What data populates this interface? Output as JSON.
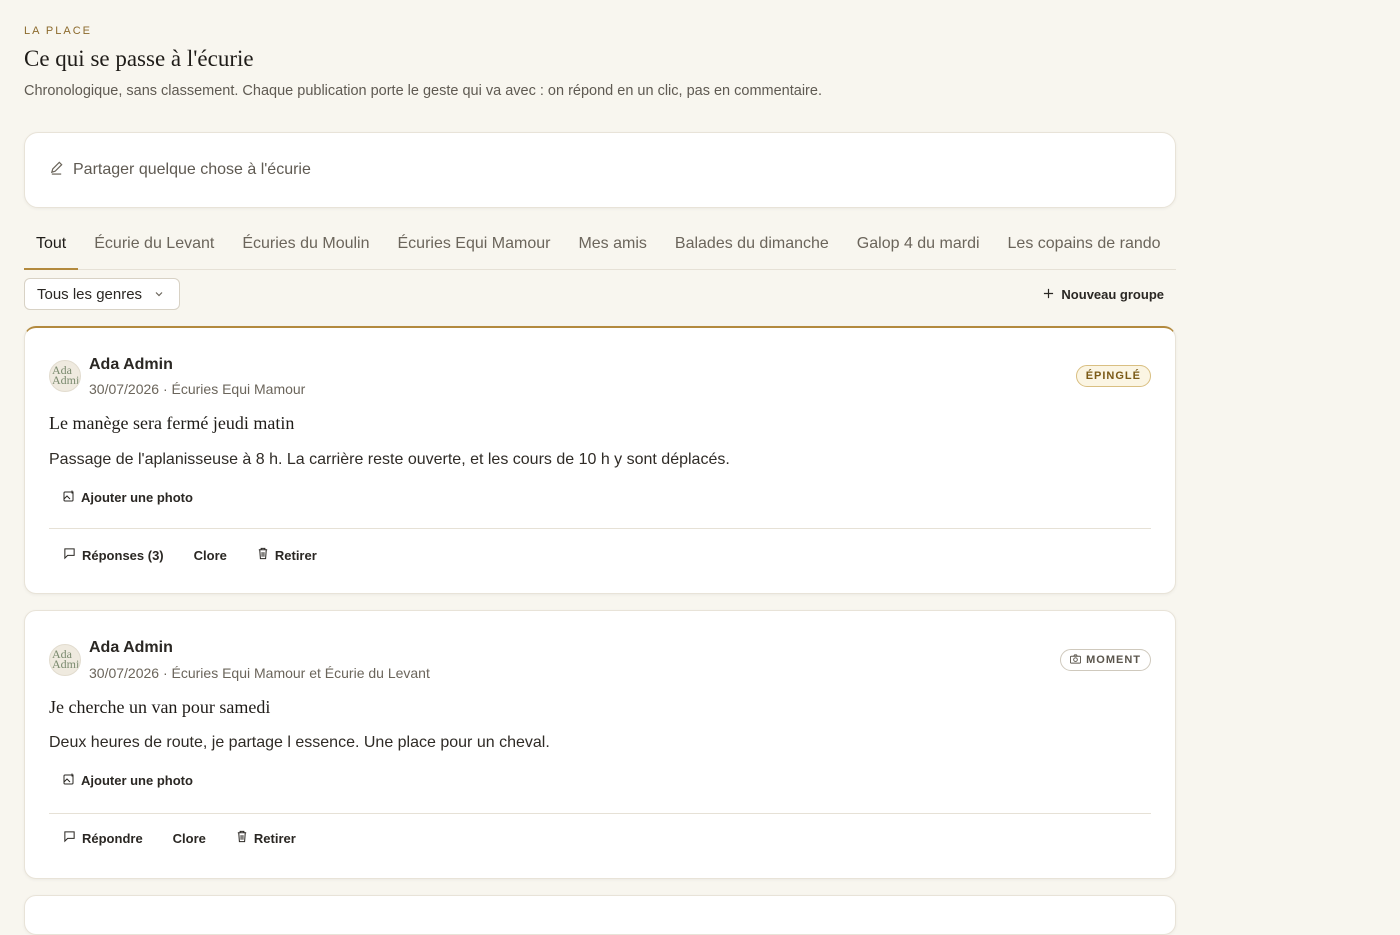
{
  "header": {
    "eyebrow": "LA PLACE",
    "title": "Ce qui se passe à l'écurie",
    "subtitle": "Chronologique, sans classement. Chaque publication porte le geste qui va avec : on répond en un clic, pas en commentaire."
  },
  "composer": {
    "placeholder": "Partager quelque chose à l'écurie",
    "icon": "pencil-icon"
  },
  "tabs": [
    {
      "label": "Tout",
      "active": true
    },
    {
      "label": "Écurie du Levant"
    },
    {
      "label": "Écuries du Moulin"
    },
    {
      "label": "Écuries Equi Mamour"
    },
    {
      "label": "Mes amis"
    },
    {
      "label": "Balades du dimanche"
    },
    {
      "label": "Galop 4 du mardi"
    },
    {
      "label": "Les copains de rando"
    }
  ],
  "toolbar": {
    "genre_select": "Tous les genres",
    "new_group": "Nouveau groupe"
  },
  "posts": [
    {
      "avatar_alt": "Ada Admin",
      "author": "Ada Admin",
      "meta": "30/07/2026 · Écuries Equi Mamour",
      "badge": "ÉPINGLÉ",
      "title": "Le manège sera fermé jeudi matin",
      "body": "Passage de l'aplanisseuse à 8 h. La carrière reste ouverte, et les cours de 10 h y sont déplacés.",
      "photo_label": "Ajouter une photo",
      "actions": {
        "reply": "Réponses (3)",
        "close": "Clore",
        "remove": "Retirer"
      }
    },
    {
      "avatar_alt": "Ada Admin",
      "author": "Ada Admin",
      "meta": "30/07/2026 · Écuries Equi Mamour et Écurie du Levant",
      "badge": "MOMENT",
      "title": "Je cherche un van pour samedi",
      "body": "Deux heures de route, je partage l essence. Une place pour un cheval.",
      "photo_label": "Ajouter une photo",
      "actions": {
        "reply": "Répondre",
        "close": "Clore",
        "remove": "Retirer"
      }
    }
  ],
  "colors": {
    "background": "#f8f6ef",
    "accent": "#b38a3e"
  }
}
